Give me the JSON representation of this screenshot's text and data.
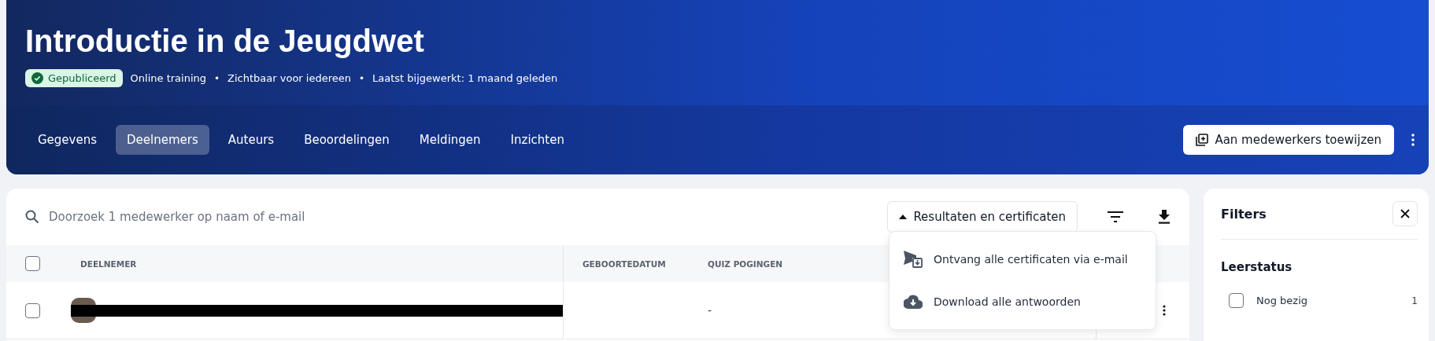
{
  "course": {
    "title": "Introductie in de Jeugdwet",
    "status": {
      "label": "Gepubliceerd",
      "kind": "published"
    },
    "meta": [
      "Online training",
      "Zichtbaar voor iedereen",
      "Laatst bijgewerkt: 1 maand geleden"
    ],
    "meta_separator": "•"
  },
  "tabs": [
    {
      "label": "Gegevens",
      "selected": false
    },
    {
      "label": "Deelnemers",
      "selected": true
    },
    {
      "label": "Auteurs",
      "selected": false
    },
    {
      "label": "Beoordelingen",
      "selected": false
    },
    {
      "label": "Meldingen",
      "selected": false
    },
    {
      "label": "Inzichten",
      "selected": false
    }
  ],
  "assign_button": {
    "label": "Aan medewerkers toewijzen"
  },
  "search": {
    "placeholder": "Doorzoek 1 medewerker op naam of e-mail"
  },
  "results_button": {
    "label": "Resultaten en certificaten",
    "expanded": true
  },
  "results_menu": [
    {
      "label": "Ontvang alle certificaten via e-mail",
      "kind": "email"
    },
    {
      "label": "Download alle antwoorden",
      "kind": "download"
    }
  ],
  "table": {
    "select_all_checked": false,
    "columns": [
      "DEELNEMER",
      "GEBOORTEDATUM",
      "QUIZ POGINGEN"
    ],
    "rows": [
      {
        "checked": false,
        "quiz_attempts": "-"
      }
    ]
  },
  "filters": {
    "title": "Filters",
    "groups": [
      {
        "title": "Leerstatus",
        "options": [
          {
            "label": "Nog bezig",
            "count": "1",
            "checked": false
          }
        ]
      }
    ]
  }
}
